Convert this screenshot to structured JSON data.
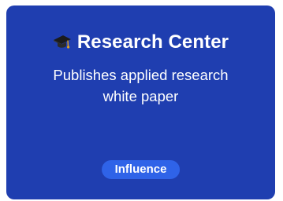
{
  "card": {
    "icon": "graduation-cap-icon",
    "title": "Research Center",
    "description": "Publishes applied research white paper",
    "badge": "Influence",
    "colors": {
      "card_background": "#1f3eb0",
      "badge_background": "#2f63e8",
      "text": "#ffffff"
    }
  }
}
